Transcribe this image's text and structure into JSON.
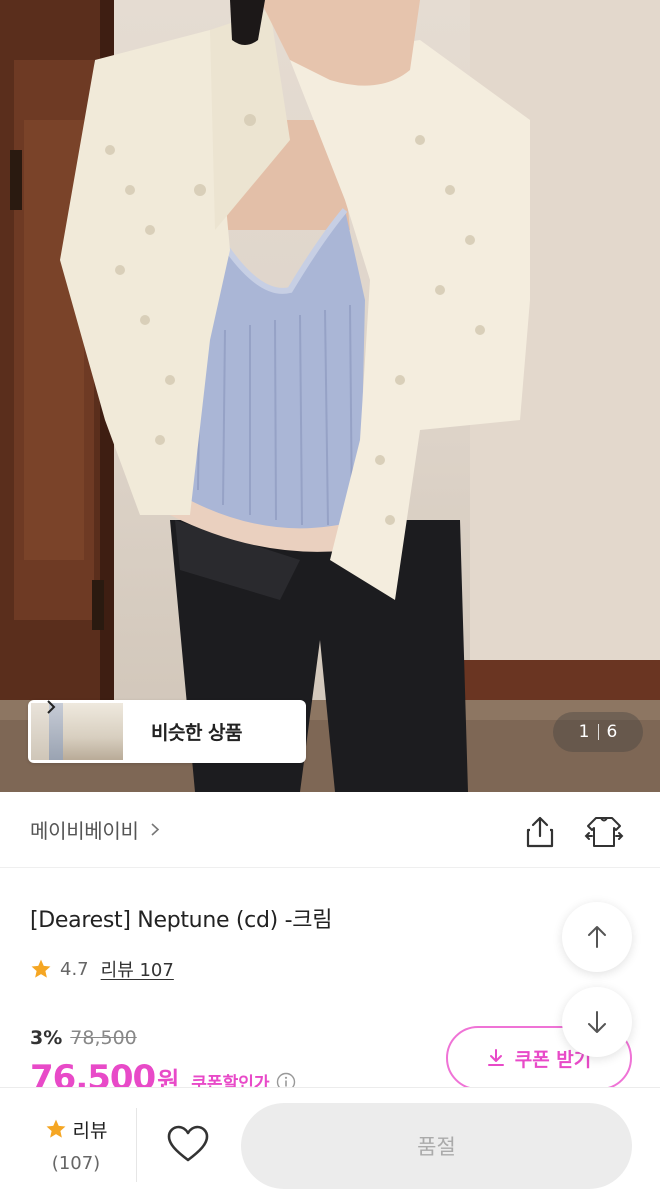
{
  "hero": {
    "similar_products_label": "비슷한 상품",
    "image_counter": {
      "current": "1",
      "total": "6"
    }
  },
  "brand": {
    "name": "메이비베이비",
    "icons": [
      "chevron-right-icon",
      "share-icon",
      "closet-icon"
    ]
  },
  "product": {
    "title": "[Dearest] Neptune (cd) -크림",
    "rating": "4.7",
    "review_link": "리뷰 107",
    "discount_percent": "3%",
    "original_price": "78,500",
    "sale_price": "76,500",
    "currency": "원",
    "coupon_price_label": "쿠폰할인가",
    "coupon_button": "쿠폰 받기"
  },
  "bottom_bar": {
    "review_label": "리뷰",
    "review_count": "(107)",
    "buy_button": "품절"
  },
  "colors": {
    "accent_pink": "#e84ac8",
    "star_orange": "#f5a623",
    "disabled_gray": "#ececec"
  }
}
